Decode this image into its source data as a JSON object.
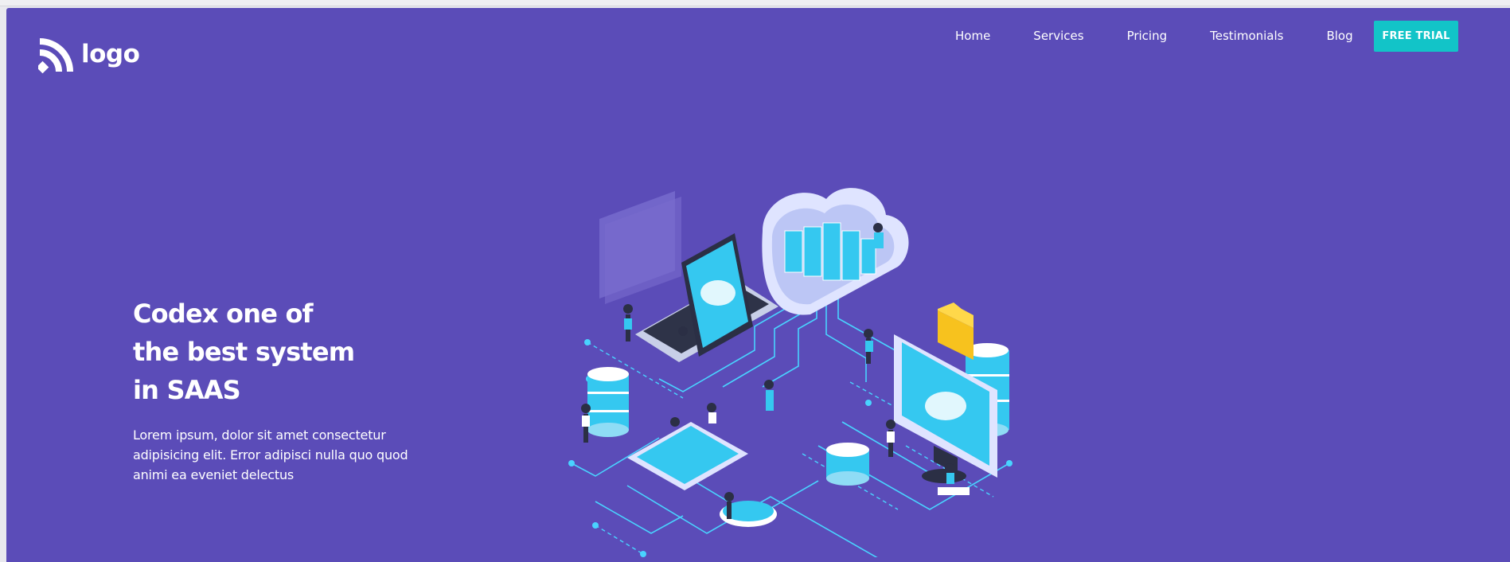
{
  "header": {
    "logo_text": "logo",
    "logo_icon": "signal-arcs-icon",
    "nav": [
      {
        "label": "Home"
      },
      {
        "label": "Services"
      },
      {
        "label": "Pricing"
      },
      {
        "label": "Testimonials"
      },
      {
        "label": "Blog"
      }
    ],
    "cta_label": "FREE TRIAL"
  },
  "hero": {
    "title_lines": [
      "Codex one of",
      "the best system",
      "in SAAS"
    ],
    "description": "Lorem ipsum, dolor sit amet consectetur adipisicing elit. Error adipisci nulla quo quod animi ea eveniet delectus",
    "illustration": "isometric-cloud-network-illustration"
  },
  "colors": {
    "background": "#5b4cb8",
    "accent": "#12c4c8",
    "text": "#ffffff",
    "illustration_cyan": "#35c8f0",
    "illustration_line": "#49d3ff"
  }
}
